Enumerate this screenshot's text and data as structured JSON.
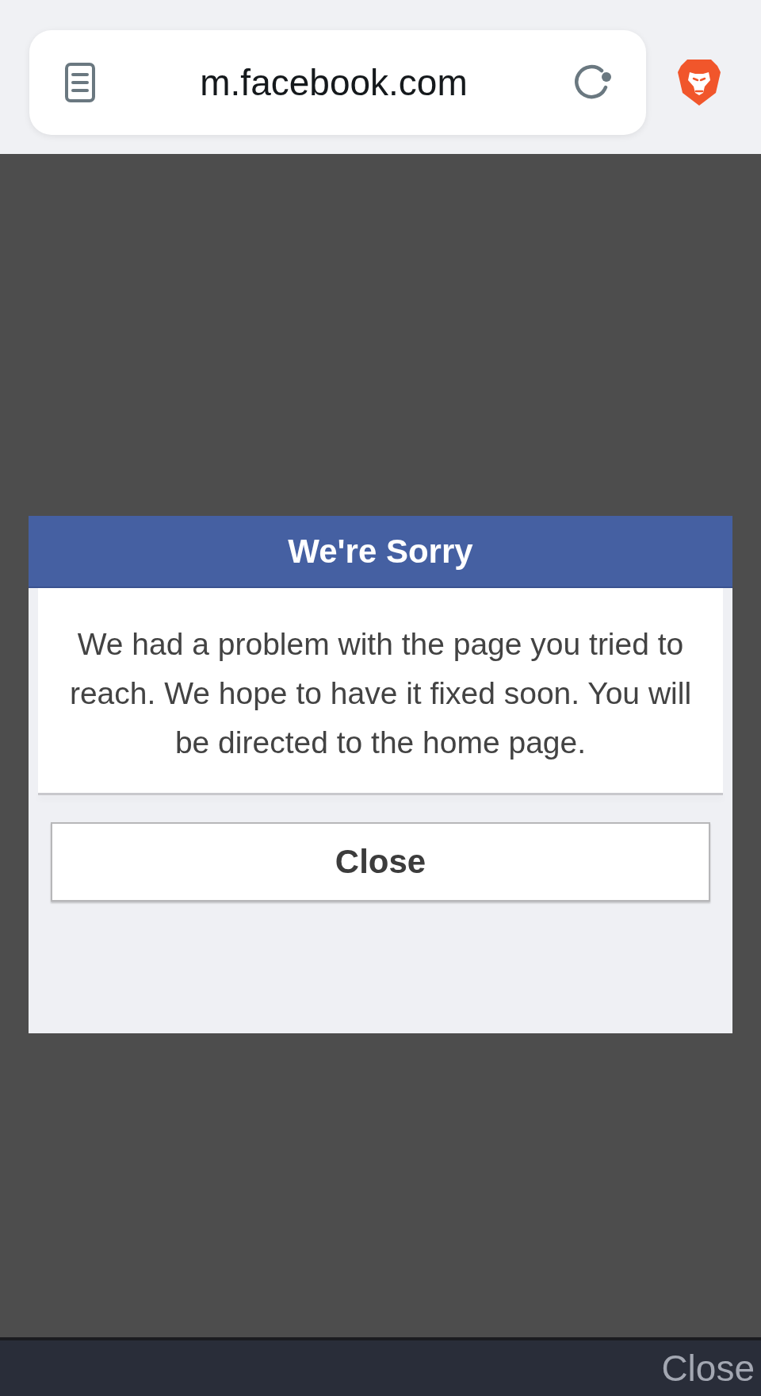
{
  "address_bar": {
    "url": "m.facebook.com"
  },
  "dialog": {
    "title": "We're Sorry",
    "message": "We had a problem with the page you tried to reach. We hope to have it fixed soon. You will be directed to the home page.",
    "button": "Close"
  },
  "bottom_bar": {
    "button": "Close"
  }
}
